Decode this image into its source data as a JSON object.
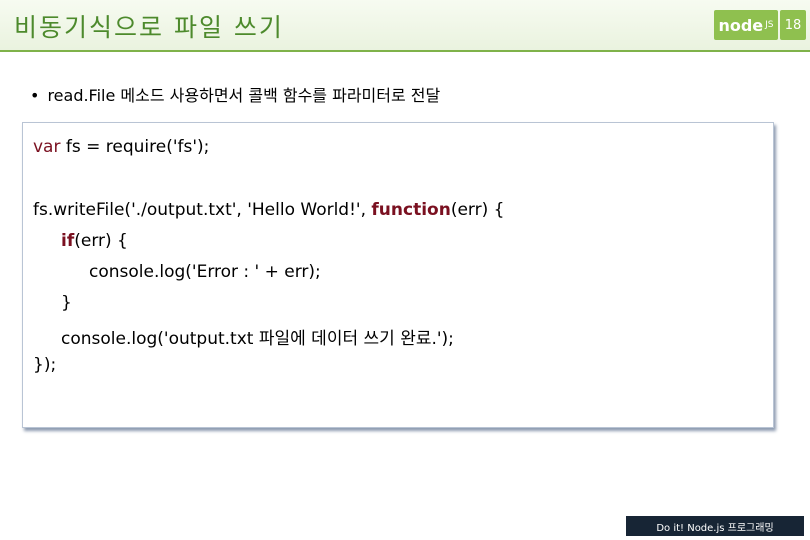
{
  "header": {
    "title": "비동기식으로 파일 쓰기",
    "logo_text": "node",
    "logo_suffix": "JS",
    "page_number": "18"
  },
  "bullet": {
    "symbol": "•",
    "text": "read.File 메소드 사용하면서 콜백 함수를 파라미터로 전달"
  },
  "code": {
    "line1": {
      "kw": "var",
      "rest": " fs = require('fs');"
    },
    "line2": {
      "pre": "fs.writeFile('./output.txt', 'Hello World!', ",
      "kw": "function",
      "post": "(err) {"
    },
    "line3": {
      "kw": "if",
      "post": "(err) {"
    },
    "line4": {
      "text": "console.log('Error : ' + err);"
    },
    "line5": {
      "text": "}"
    },
    "line6": {
      "text": "console.log('output.txt 파일에 데이터 쓰기 완료.');"
    },
    "line7": {
      "text": "});"
    }
  },
  "footer": {
    "text": "Do it! Node.js 프로그래밍"
  }
}
